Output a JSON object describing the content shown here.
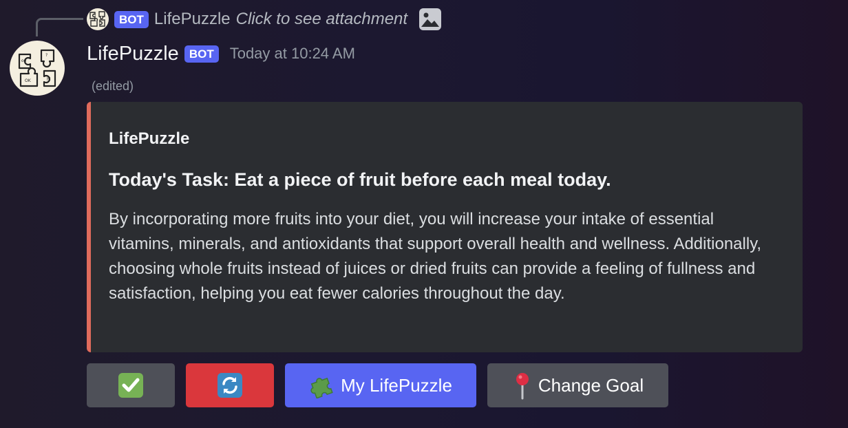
{
  "reply": {
    "bot_tag": "BOT",
    "name": "LifePuzzle",
    "text": "Click to see attachment",
    "attachment_icon": "image-icon"
  },
  "message": {
    "username": "LifePuzzle",
    "bot_tag": "BOT",
    "timestamp": "Today at 10:24 AM",
    "edited": "(edited)"
  },
  "embed": {
    "author": "LifePuzzle",
    "title": "Today's Task: Eat a piece of fruit before each meal today.",
    "description": "By incorporating more fruits into your diet, you will increase your intake of essential vitamins, minerals, and antioxidants that support overall health and wellness. Additionally, choosing whole fruits instead of juices or dried fruits can provide a feeling of fullness and satisfaction, helping you eat fewer calories throughout the day.",
    "accent_color": "#e06b5c"
  },
  "buttons": [
    {
      "icon": "check-mark-icon",
      "label": ""
    },
    {
      "icon": "refresh-icon",
      "label": ""
    },
    {
      "icon": "puzzle-piece-icon",
      "label": "My LifePuzzle"
    },
    {
      "icon": "pushpin-icon",
      "label": "Change Goal"
    }
  ],
  "colors": {
    "blurple": "#5865f2",
    "danger": "#da373c",
    "secondary": "#4e5058",
    "embed_bg": "#2b2d31"
  }
}
